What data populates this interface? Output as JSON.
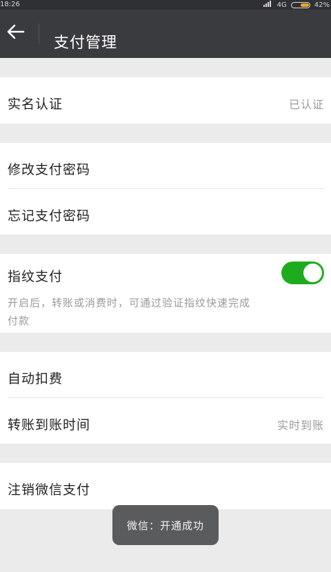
{
  "status_bar": {
    "time": "18:26",
    "network": "4G",
    "battery_percent": "42%"
  },
  "app_bar": {
    "back_icon": "arrow-left-icon",
    "title": "支付管理"
  },
  "sections": [
    {
      "rows": [
        {
          "label": "实名认证",
          "value": "已认证"
        }
      ]
    },
    {
      "rows": [
        {
          "label": "修改支付密码"
        },
        {
          "label": "忘记支付密码"
        }
      ]
    },
    {
      "rows": [
        {
          "label": "指纹支付",
          "toggle_on": true
        }
      ],
      "description": "开启后，转账或消费时，可通过验证指纹快速完成付款"
    },
    {
      "rows": [
        {
          "label": "自动扣费"
        },
        {
          "label": "转账到账时间",
          "value": "实时到账"
        }
      ]
    },
    {
      "rows": [
        {
          "label": "注销微信支付"
        }
      ]
    }
  ],
  "toast": {
    "text": "微信：开通成功"
  },
  "colors": {
    "app_bar": "#3a3b3f",
    "toggle_on": "#1eac1e",
    "background": "#ebebeb"
  }
}
